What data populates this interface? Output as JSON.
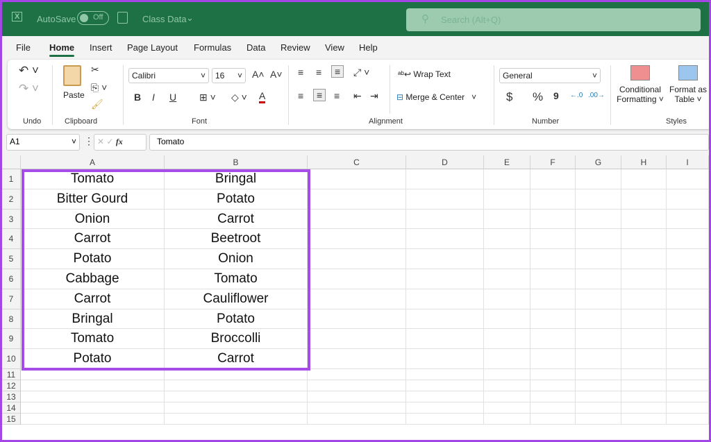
{
  "titlebar": {
    "autosave_label": "AutoSave",
    "autosave_state": "Off",
    "filename": "Class Data",
    "search_placeholder": "Search (Alt+Q)",
    "bg_color": "#1e7145"
  },
  "menu": [
    "File",
    "Home",
    "Insert",
    "Page Layout",
    "Formulas",
    "Data",
    "Review",
    "View",
    "Help"
  ],
  "active_menu": "Home",
  "ribbon": {
    "groups": {
      "undo": "Undo",
      "clipboard": "Clipboard",
      "font": "Font",
      "alignment": "Alignment",
      "number": "Number",
      "styles": "Styles"
    },
    "paste": "Paste",
    "font_name": "Calibri",
    "font_size": "16",
    "wrap_text": "Wrap Text",
    "merge_center": "Merge & Center",
    "number_format": "General",
    "conditional_formatting": [
      "Conditional",
      "Formatting"
    ],
    "format_as_table": [
      "Format as",
      "Table"
    ],
    "bold": "B",
    "italic": "I",
    "underline": "U",
    "currency": "$",
    "percent": "%",
    "comma": "9"
  },
  "formula_bar": {
    "name_box": "A1",
    "fx": "fx",
    "value": "Tomato"
  },
  "columns": [
    "A",
    "B",
    "C",
    "D",
    "E",
    "F",
    "G",
    "H",
    "I"
  ],
  "rows": [
    "1",
    "2",
    "3",
    "4",
    "5",
    "6",
    "7",
    "8",
    "9",
    "10",
    "11",
    "12",
    "13",
    "14",
    "15"
  ],
  "cells": [
    [
      "Tomato",
      "Bringal"
    ],
    [
      "Bitter Gourd",
      "Potato"
    ],
    [
      "Onion",
      "Carrot"
    ],
    [
      "Carrot",
      "Beetroot"
    ],
    [
      "Potato",
      "Onion"
    ],
    [
      "Cabbage",
      "Tomato"
    ],
    [
      "Carrot",
      "Cauliflower"
    ],
    [
      "Bringal",
      "Potato"
    ],
    [
      "Tomato",
      "Broccolli"
    ],
    [
      "Potato",
      "Carrot"
    ]
  ],
  "selection_color": "#a64ce8"
}
